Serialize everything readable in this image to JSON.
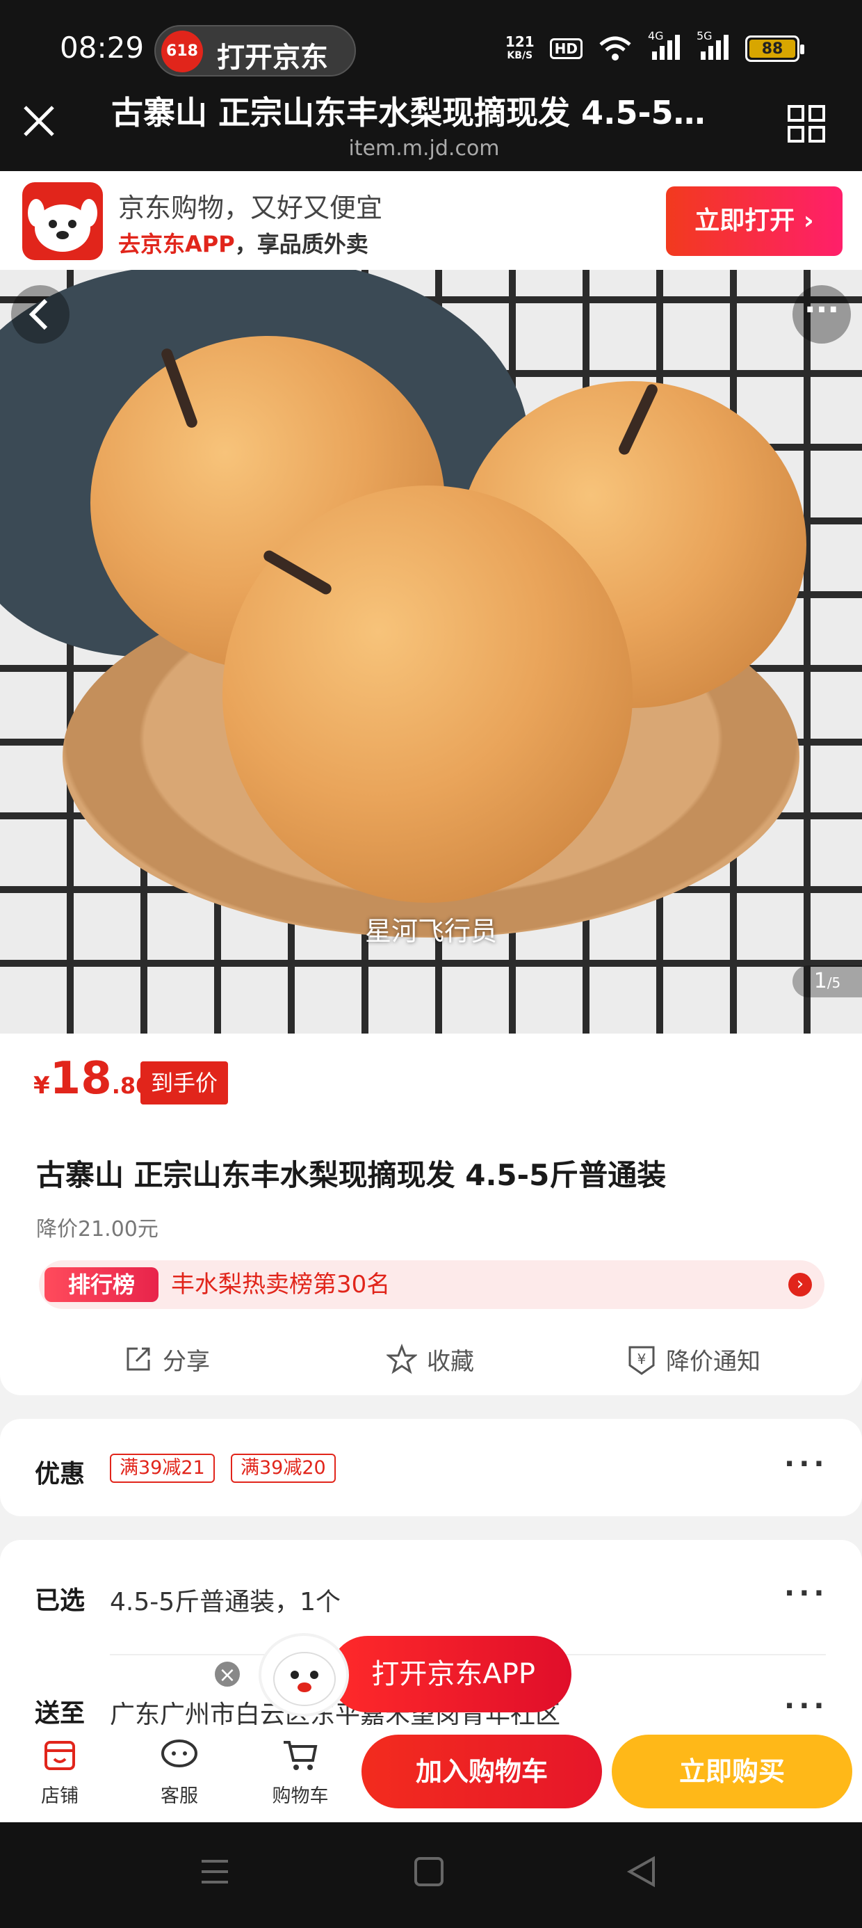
{
  "status_bar": {
    "time": "08:29",
    "open_app_pill": "打开京东",
    "pill_badge": "618",
    "net_speed": "121",
    "net_unit": "KB/S",
    "hd": "HD",
    "sim1": "4G",
    "sim2": "5G",
    "battery": "88"
  },
  "header": {
    "title": "古寨山 正宗山东丰水梨现摘现发 4.5-5斤...",
    "url": "item.m.jd.com"
  },
  "banner": {
    "line1": "京东购物，又好又便宜",
    "line2_red": "去京东APP",
    "line2_rest": "，享品质外卖",
    "button": "立即打开"
  },
  "hero": {
    "watermark": "星河飞行员",
    "pager_current": "1",
    "pager_total": "/5"
  },
  "product": {
    "price_symbol": "¥",
    "price_int": "18",
    "price_dec": ".80",
    "price_tag": "到手价",
    "title": "古寨山 正宗山东丰水梨现摘现发 4.5-5斤普通装",
    "price_drop": "降价21.00元",
    "rank_badge": "排行榜",
    "rank_text": "丰水梨热卖榜第30名",
    "actions": {
      "share": "分享",
      "favorite": "收藏",
      "price_alert": "降价通知"
    }
  },
  "promo": {
    "label": "优惠",
    "coupons": [
      "满39减21",
      "满39减20"
    ]
  },
  "selection": {
    "label": "已选",
    "value": "4.5-5斤普通装，1个",
    "ship_label": "送至",
    "ship_value": "广东广州市白云区东平嘉禾望岗青年社区"
  },
  "float_cta": {
    "label": "打开京东APP"
  },
  "bottom_bar": {
    "store": "店铺",
    "service": "客服",
    "cart": "购物车",
    "add_cart": "加入购物车",
    "buy_now": "立即购买"
  },
  "colors": {
    "brand_red": "#e1251b",
    "buy_yellow": "#ffb818"
  }
}
